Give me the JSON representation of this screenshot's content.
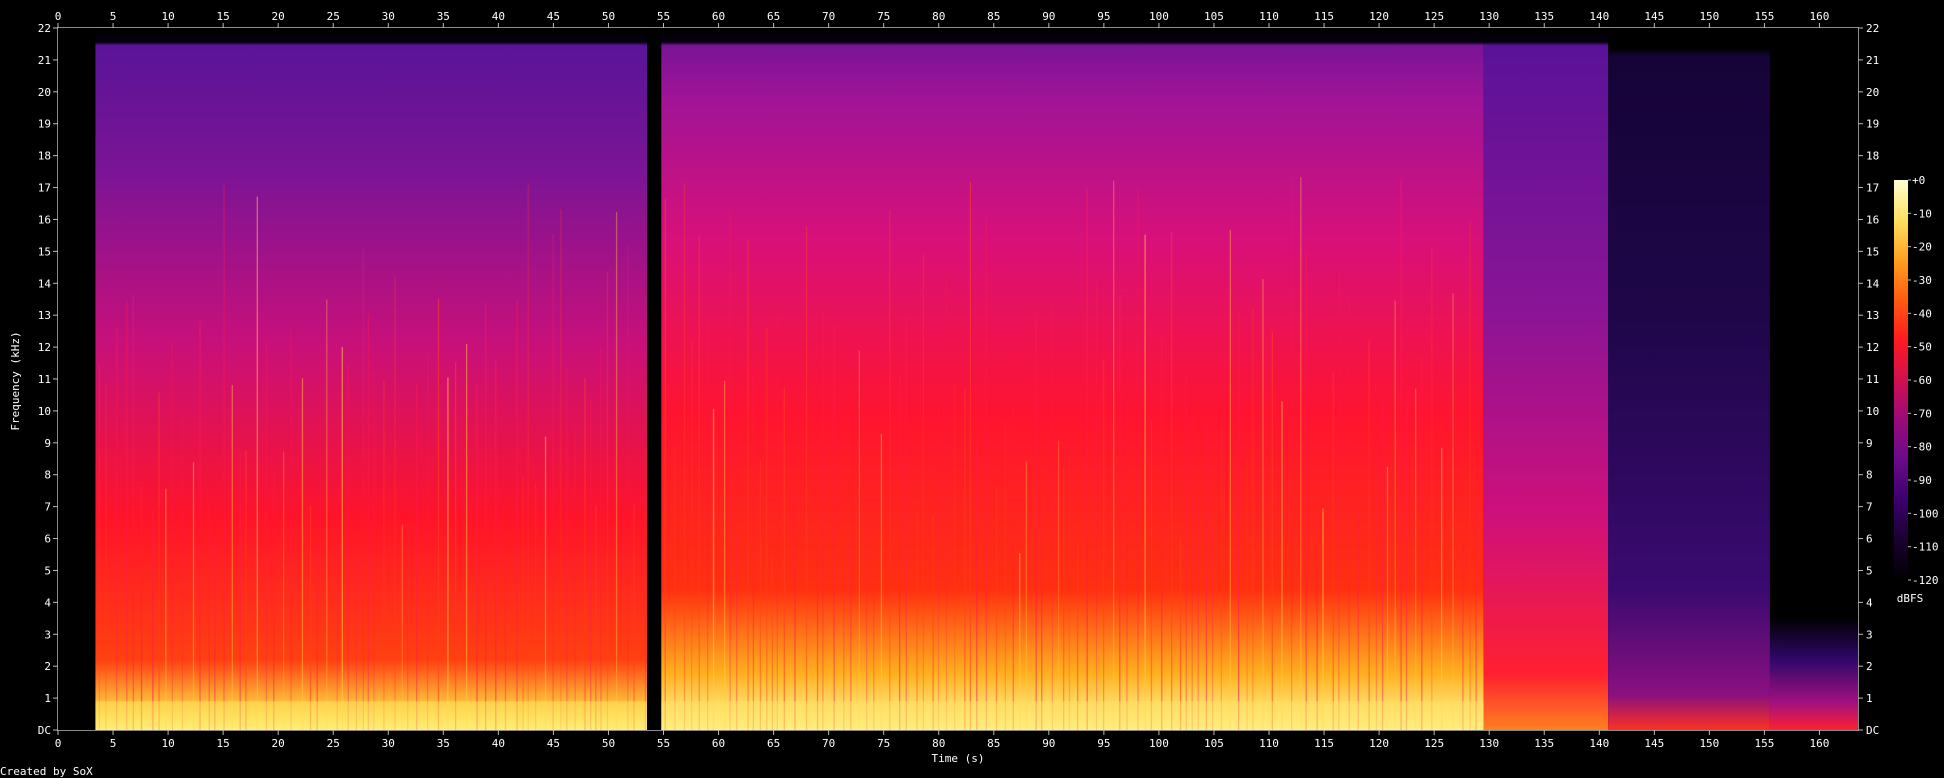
{
  "chart_data": {
    "type": "heatmap",
    "title": "",
    "xlabel": "Time (s)",
    "ylabel": "Frequency (kHz)",
    "xlim": [
      0,
      163.5
    ],
    "ylim": [
      0,
      22
    ],
    "x_ticks": [
      0,
      5,
      10,
      15,
      20,
      25,
      30,
      35,
      40,
      45,
      50,
      55,
      60,
      65,
      70,
      75,
      80,
      85,
      90,
      95,
      100,
      105,
      110,
      115,
      120,
      125,
      130,
      135,
      140,
      145,
      150,
      155,
      160
    ],
    "y_ticks": [
      0,
      1,
      2,
      3,
      4,
      5,
      6,
      7,
      8,
      9,
      10,
      11,
      12,
      13,
      14,
      15,
      16,
      17,
      18,
      19,
      20,
      21,
      22
    ],
    "y_tick_labels": [
      "DC",
      "1",
      "2",
      "3",
      "4",
      "5",
      "6",
      "7",
      "8",
      "9",
      "10",
      "11",
      "12",
      "13",
      "14",
      "15",
      "16",
      "17",
      "18",
      "19",
      "20",
      "21",
      "22"
    ],
    "colorbar": {
      "label": "dBFS",
      "range": [
        -120,
        0
      ],
      "ticks": [
        0,
        -10,
        -20,
        -30,
        -40,
        -50,
        -60,
        -70,
        -80,
        -90,
        -100,
        -110,
        -120
      ],
      "tick_labels": [
        "+0",
        "-10",
        "-20",
        "-30",
        "-40",
        "-50",
        "-60",
        "-70",
        "-80",
        "-90",
        "-100",
        "-110",
        "-120"
      ],
      "colors": [
        "#000000",
        "#1a0030",
        "#3c006e",
        "#6a0a8a",
        "#9a0a7a",
        "#d01050",
        "#ff1a20",
        "#ff5a10",
        "#ffa020",
        "#ffe060",
        "#ffffd0"
      ]
    },
    "segments": [
      {
        "start": 0,
        "end": 3.4,
        "level": "silence"
      },
      {
        "start": 3.4,
        "end": 53.5,
        "level": "loud",
        "cutoff_khz": 21.4
      },
      {
        "start": 53.5,
        "end": 54.8,
        "level": "gap"
      },
      {
        "start": 54.8,
        "end": 129.5,
        "level": "loud",
        "cutoff_khz": 21.4
      },
      {
        "start": 129.5,
        "end": 140.8,
        "level": "fade",
        "cutoff_khz": 21.4
      },
      {
        "start": 140.8,
        "end": 155.5,
        "level": "quiet",
        "cutoff_khz": 21.2
      },
      {
        "start": 155.5,
        "end": 163.5,
        "level": "tail",
        "cutoff_khz": 2.5
      }
    ]
  },
  "credit": "Created by SoX"
}
